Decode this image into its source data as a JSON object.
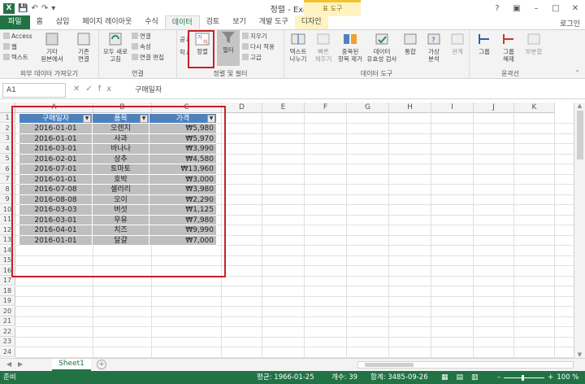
{
  "window": {
    "title": "정렬 - Excel",
    "context_header": "표 도구",
    "signin": "로그인"
  },
  "tabs": [
    "파일",
    "홈",
    "삽입",
    "페이지 레이아웃",
    "수식",
    "데이터",
    "검토",
    "보기",
    "개발 도구",
    "디자인"
  ],
  "ribbon": {
    "external": {
      "access": "Access",
      "web": "웹",
      "text": "텍스트",
      "other": "기타\n원본에서",
      "existing": "기존\n연결",
      "label": "외부 데이터 가져오기"
    },
    "connections": {
      "refresh": "모두 새로\n고침",
      "conn": "연결",
      "props": "속성",
      "edit": "연결 편집",
      "label": "연결"
    },
    "sortfilter": {
      "sort": "정렬",
      "filter": "필터",
      "clear": "지우기",
      "reapply": "다시 적용",
      "advanced": "고급",
      "az": "공↓",
      "za": "학↓",
      "label": "정렬 및 필터"
    },
    "datatools": {
      "t2c": "텍스트\n나누기",
      "flash": "빠른\n채우기",
      "dup": "중복된\n항목 제거",
      "valid": "데이터\n유효성 검사",
      "consol": "통합",
      "whatif": "가상\n분석",
      "rel": "관계",
      "label": "데이터 도구"
    },
    "outline": {
      "group": "그룹",
      "ungroup": "그룹\n해제",
      "subtotal": "부분합",
      "label": "윤곽선"
    }
  },
  "formula": {
    "namebox": "A1",
    "content": "구매일자"
  },
  "columns": [
    "A",
    "B",
    "C",
    "D",
    "E",
    "F",
    "G",
    "H",
    "I",
    "J",
    "K"
  ],
  "rows": [
    "1",
    "2",
    "3",
    "4",
    "5",
    "6",
    "7",
    "8",
    "9",
    "10",
    "11",
    "12",
    "13",
    "14",
    "15",
    "16",
    "17",
    "18",
    "19",
    "20",
    "21",
    "22",
    "23",
    "24"
  ],
  "table": {
    "headers": [
      "구매일자",
      "품목",
      "가격"
    ],
    "rows": [
      [
        "2016-01-01",
        "오렌지",
        "₩5,980"
      ],
      [
        "2016-01-01",
        "사과",
        "₩5,970"
      ],
      [
        "2016-03-01",
        "바나나",
        "₩3,990"
      ],
      [
        "2016-02-01",
        "상추",
        "₩4,580"
      ],
      [
        "2016-07-01",
        "토마토",
        "₩13,960"
      ],
      [
        "2016-01-01",
        "호박",
        "₩3,000"
      ],
      [
        "2016-07-08",
        "셀러리",
        "₩3,980"
      ],
      [
        "2016-08-08",
        "오이",
        "₩2,290"
      ],
      [
        "2016-03-03",
        "버섯",
        "₩1,125"
      ],
      [
        "2016-03-01",
        "우유",
        "₩7,980"
      ],
      [
        "2016-04-01",
        "치즈",
        "₩9,990"
      ],
      [
        "2016-01-01",
        "달걀",
        "₩7,000"
      ]
    ]
  },
  "sheet": {
    "name": "Sheet1"
  },
  "status": {
    "ready": "준비",
    "avg": "평균: 1966-01-25",
    "count": "개수: 39",
    "sum": "합계: 3485-09-26",
    "zoom": "100 %"
  }
}
